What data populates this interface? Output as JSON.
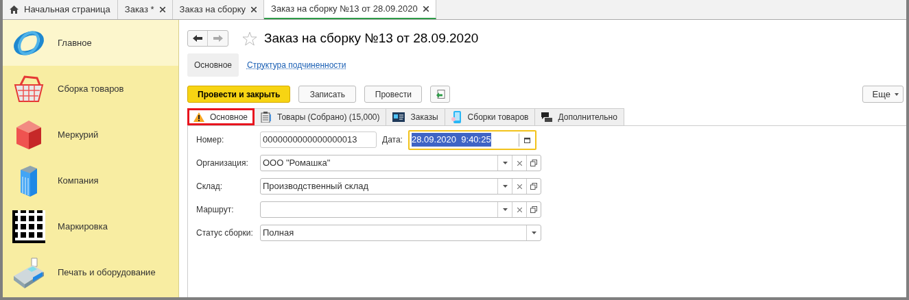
{
  "top_tabs": [
    {
      "label": "Начальная страница",
      "kind": "home",
      "selected": false
    },
    {
      "label": "Заказ *",
      "kind": "doc",
      "selected": false
    },
    {
      "label": "Заказ на сборку",
      "kind": "doc",
      "selected": false
    },
    {
      "label": "Заказ на сборку №13 от 28.09.2020",
      "kind": "doc",
      "selected": true
    }
  ],
  "sidebar": {
    "items": [
      {
        "label": "Главное",
        "selected": true
      },
      {
        "label": "Сборка товаров",
        "selected": false
      },
      {
        "label": "Меркурий",
        "selected": false
      },
      {
        "label": "Компания",
        "selected": false
      },
      {
        "label": "Маркировка",
        "selected": false
      },
      {
        "label": "Печать и оборудование",
        "selected": false
      }
    ]
  },
  "form": {
    "title": "Заказ на сборку №13 от 28.09.2020",
    "sections": [
      {
        "label": "Основное",
        "selected": true
      },
      {
        "label": "Структура подчиненности",
        "selected": false
      }
    ],
    "buttons": [
      {
        "label": "Провести и закрыть",
        "kind": "primary"
      },
      {
        "label": "Записать",
        "kind": "plain"
      },
      {
        "label": "Провести",
        "kind": "plain"
      },
      {
        "kind": "icon"
      }
    ],
    "more": "Еще",
    "tabs": [
      {
        "label": "Основное",
        "selected": true,
        "marked": true
      },
      {
        "label": "Товары (Собрано) (15,000)",
        "selected": false,
        "marked": false
      },
      {
        "label": "Заказы",
        "selected": false,
        "marked": false
      },
      {
        "label": "Сборки товаров",
        "selected": false,
        "marked": false
      },
      {
        "label": "Дополнительно",
        "selected": false,
        "marked": false
      }
    ],
    "number": {
      "label": "Номер:",
      "value": "0000000000000000013"
    },
    "date": {
      "label": "Дата:",
      "value": "28.09.2020  9:40:25",
      "focused": true
    },
    "fields": [
      {
        "label": "Организация:",
        "value": "ООО \"Ромашка\"",
        "kind": "ref"
      },
      {
        "label": "Склад:",
        "value": "Производственный склад",
        "kind": "ref"
      },
      {
        "label": "Маршрут:",
        "kind": "ref"
      },
      {
        "label": "Статус сборки:",
        "value": "Полная",
        "kind": "enum"
      }
    ]
  }
}
